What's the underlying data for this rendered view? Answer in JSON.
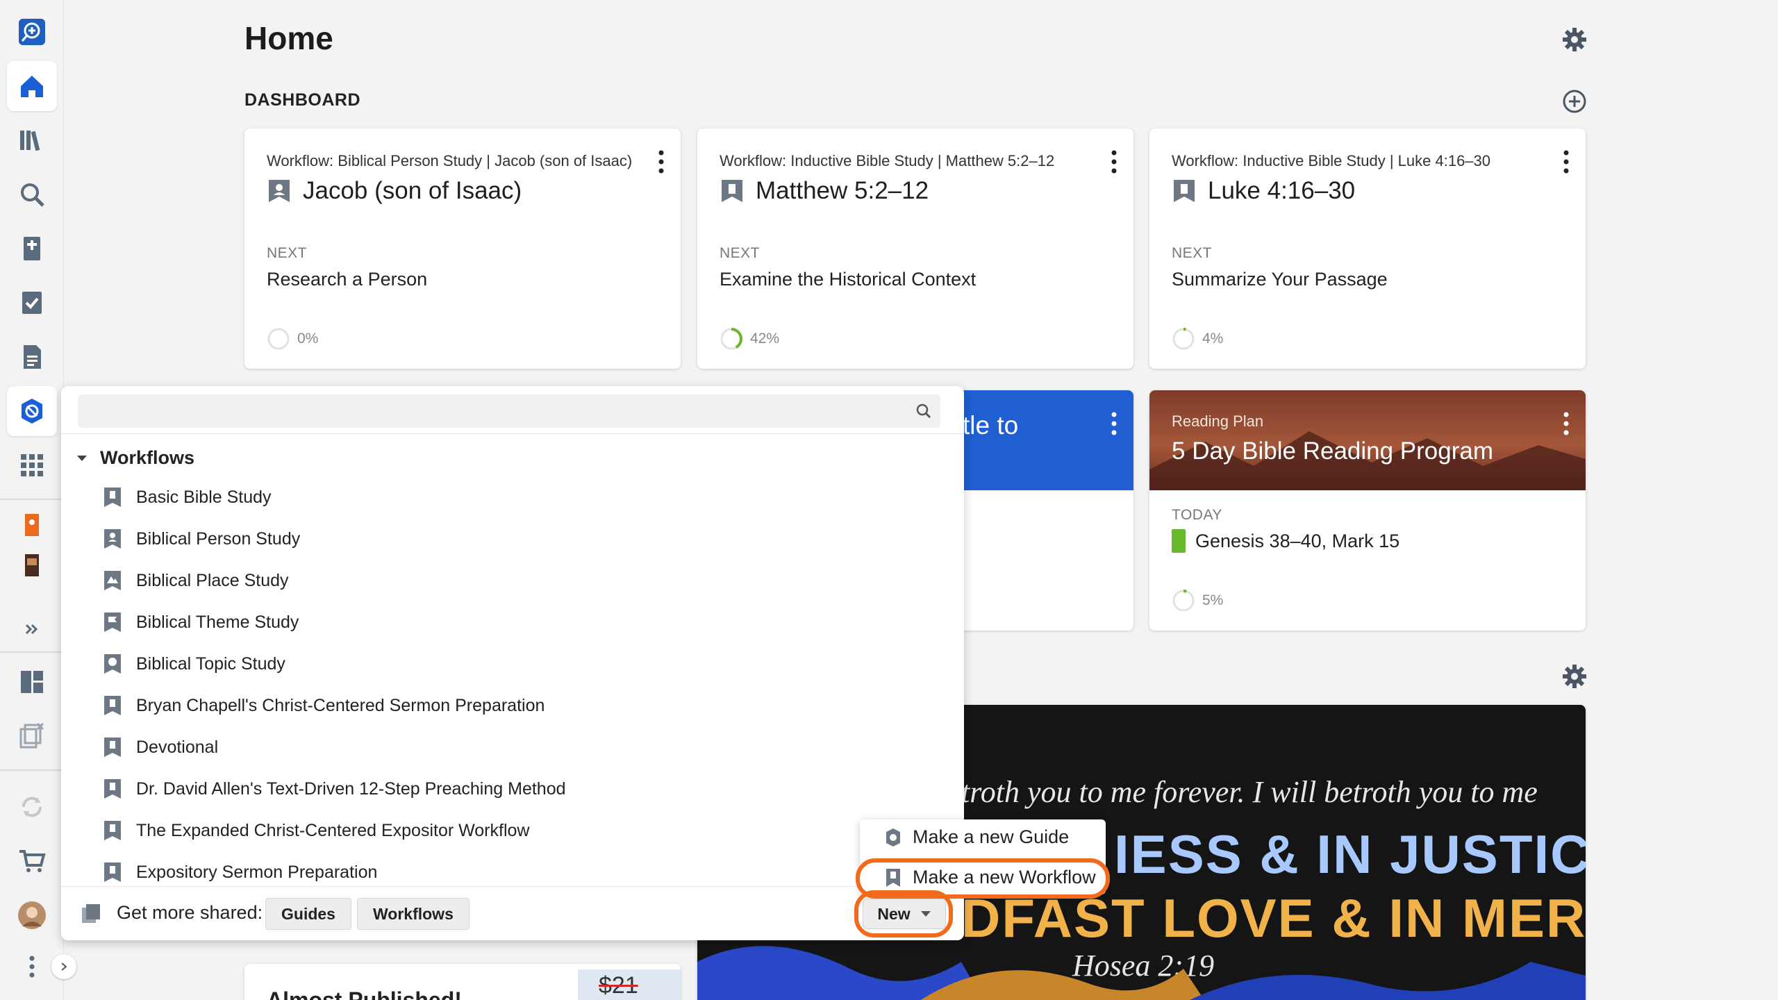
{
  "page": {
    "title": "Home"
  },
  "dashboard": {
    "label": "DASHBOARD",
    "workflow_cards": [
      {
        "subtitle": "Workflow: Biblical Person Study | Jacob (son of Isaac)",
        "title": "Jacob (son of Isaac)",
        "next_label": "NEXT",
        "next": "Research a Person",
        "progress_text": "0%",
        "progress": 0
      },
      {
        "subtitle": "Workflow: Inductive Bible Study | Matthew 5:2–12",
        "title": "Matthew 5:2–12",
        "next_label": "NEXT",
        "next": "Examine the Historical Context",
        "progress_text": "42%",
        "progress": 0.42
      },
      {
        "subtitle": "Workflow: Inductive Bible Study | Luke 4:16–30",
        "title": "Luke 4:16–30",
        "next_label": "NEXT",
        "next": "Summarize Your Passage",
        "progress_text": "4%",
        "progress": 0.04
      }
    ],
    "blue_card": {
      "partial_title": "tle to"
    },
    "reading_plan": {
      "kind": "Reading Plan",
      "name": "5 Day Bible Reading Program",
      "today_label": "TODAY",
      "reading": "Genesis 38–40, Mark 15",
      "progress_text": "5%",
      "progress": 0.05
    },
    "verse_card": {
      "line1": "troth you to me forever. I will betroth you to me",
      "line2": "IESS & IN JUSTICE,",
      "line3": "DFAST LOVE & IN MERCY.",
      "reference": "Hosea 2:19"
    },
    "publish_card": {
      "text": "Almost Published!",
      "price": "$21"
    }
  },
  "panel": {
    "search": {
      "value": "",
      "placeholder": ""
    },
    "group_label": "Workflows",
    "items": [
      "Basic Bible Study",
      "Biblical Person Study",
      "Biblical Place Study",
      "Biblical Theme Study",
      "Biblical Topic Study",
      "Bryan Chapell's Christ-Centered Sermon Preparation",
      "Devotional",
      "Dr. David Allen's Text-Driven 12-Step Preaching Method",
      "The Expanded Christ-Centered Expositor Workflow",
      "Expository Sermon Preparation"
    ],
    "footer": {
      "label": "Get more shared:",
      "guides": "Guides",
      "workflows": "Workflows"
    }
  },
  "new_menu": {
    "button": "New",
    "items": [
      "Make a new Guide",
      "Make a new Workflow"
    ]
  },
  "colors": {
    "accent": "#1a5fd6",
    "highlight": "#f26b1d",
    "progress": "#68b82e"
  }
}
